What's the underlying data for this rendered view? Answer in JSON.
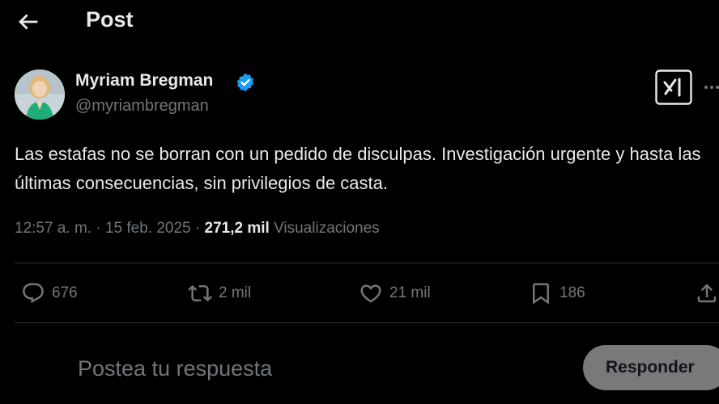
{
  "header": {
    "title": "Post",
    "back_icon": "arrow-left-icon"
  },
  "author": {
    "name": "Myriam Bregman",
    "handle": "@myriambregman",
    "verified_color": "#1d9bf0"
  },
  "tweet": {
    "text": "Las estafas no se borran con un pedido de disculpas. Investigación urgente y hasta las últimas consecuencias, sin privilegios de casta.",
    "time": "12:57 a. m.",
    "separator": " · ",
    "date": "15 feb. 2025",
    "views_count": "271,2 mil",
    "views_label": "Visualizaciones"
  },
  "actions": {
    "replies": "676",
    "reposts": "2 mil",
    "likes": "21 mil",
    "bookmarks": "186"
  },
  "composer": {
    "placeholder": "Postea tu respuesta",
    "submit_label": "Responder"
  }
}
